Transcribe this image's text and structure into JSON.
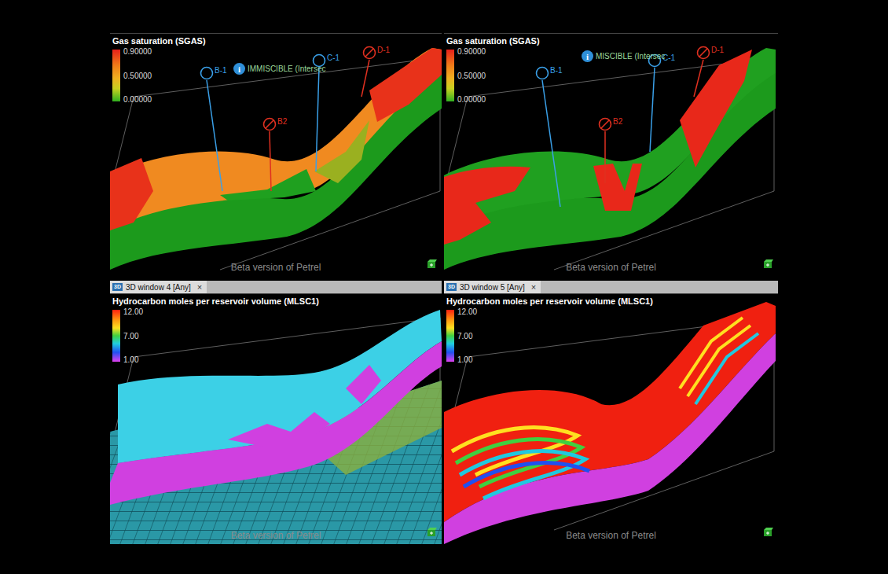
{
  "views": [
    {
      "kind": "gas1",
      "window_tab": null,
      "title": "Gas saturation (SGAS)",
      "legend": [
        "0.90000",
        "0.50000",
        "0.00000"
      ],
      "info": {
        "icon": "i",
        "label": "IMMISCIBLE (Intersec"
      },
      "wells": [
        {
          "name": "B-1",
          "kind": "open"
        },
        {
          "name": "B2",
          "kind": "plugged"
        },
        {
          "name": "C-1",
          "kind": "open"
        },
        {
          "name": "D-1",
          "kind": "plugged"
        }
      ],
      "watermark": "Beta version of Petrel"
    },
    {
      "kind": "gas2",
      "window_tab": null,
      "title": "Gas saturation (SGAS)",
      "legend": [
        "0.90000",
        "0.50000",
        "0.00000"
      ],
      "info": {
        "icon": "i",
        "label": "MISCIBLE (Intersec"
      },
      "wells": [
        {
          "name": "B-1",
          "kind": "open"
        },
        {
          "name": "B2",
          "kind": "plugged"
        },
        {
          "name": "C-1",
          "kind": "open"
        },
        {
          "name": "D-1",
          "kind": "plugged"
        }
      ],
      "watermark": "Beta version of Petrel"
    },
    {
      "kind": "moles1",
      "window_tab": {
        "icon": "3D",
        "label": "3D window 4 [Any]",
        "close": "×",
        "selected": true
      },
      "title": "Hydrocarbon moles per reservoir volume (MLSC1)",
      "legend": [
        "12.00",
        "7.00",
        "1.00"
      ],
      "info": null,
      "wells": [],
      "watermark": "Beta version of Petrel"
    },
    {
      "kind": "moles2",
      "window_tab": {
        "icon": "3D",
        "label": "3D window 5 [Any]",
        "close": "×",
        "selected": true
      },
      "title": "Hydrocarbon moles per reservoir volume (MLSC1)",
      "legend": [
        "12.00",
        "7.00",
        "1.00"
      ],
      "info": null,
      "wells": [],
      "watermark": "Beta version of Petrel"
    }
  ]
}
